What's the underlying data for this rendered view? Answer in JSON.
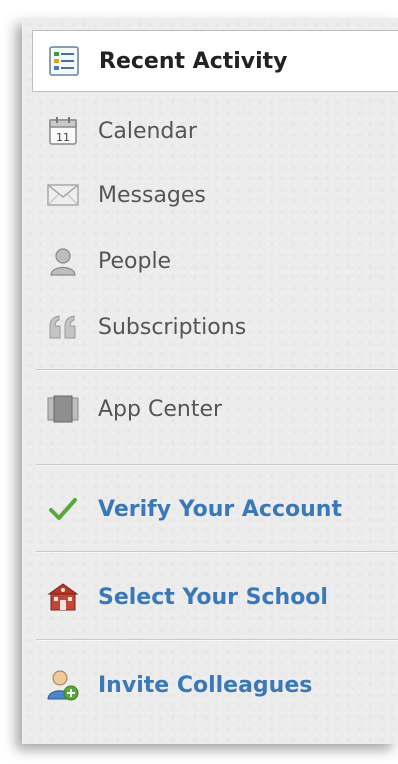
{
  "nav": {
    "items": [
      {
        "label": "Recent Activity",
        "icon": "recent-activity-icon",
        "active": true
      },
      {
        "label": "Calendar",
        "icon": "calendar-icon",
        "calendar_day": "11"
      },
      {
        "label": "Messages",
        "icon": "envelope-icon"
      },
      {
        "label": "People",
        "icon": "person-icon"
      },
      {
        "label": "Subscriptions",
        "icon": "quote-icon"
      }
    ]
  },
  "apps": {
    "label": "App Center",
    "icon": "app-center-icon"
  },
  "actions": [
    {
      "label": "Verify Your Account",
      "icon": "checkmark-icon"
    },
    {
      "label": "Select Your School",
      "icon": "school-icon"
    },
    {
      "label": "Invite Colleagues",
      "icon": "add-user-icon"
    }
  ],
  "colors": {
    "action_text": "#3a78b8",
    "active_text": "#222222",
    "normal_text": "#555555",
    "check_green": "#5aa83a",
    "school_red": "#b2382a"
  }
}
